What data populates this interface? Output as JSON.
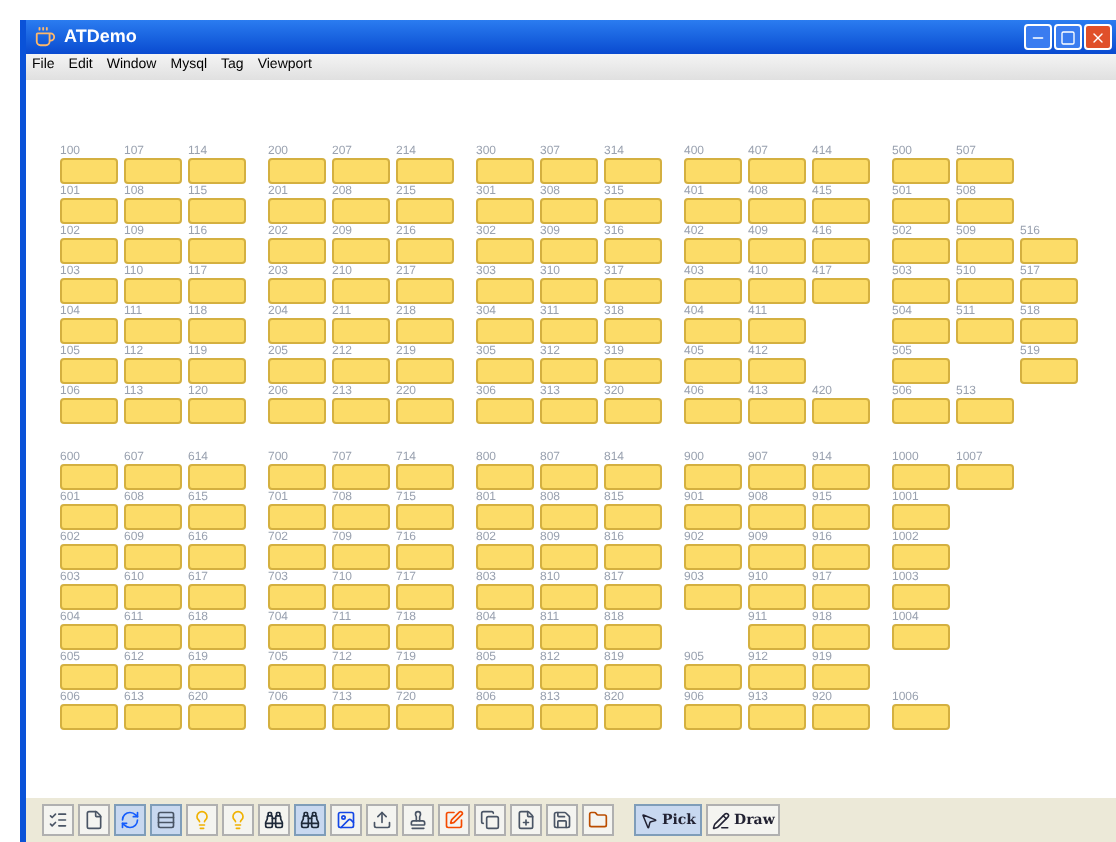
{
  "window": {
    "title": "ATDemo"
  },
  "menu": [
    "File",
    "Edit",
    "Window",
    "Mysql",
    "Tag",
    "Viewport"
  ],
  "bands": [
    {
      "groups": [
        {
          "columns": [
            {
              "cells": [
                {
                  "kind": "note",
                  "label": "100"
                },
                {
                  "kind": "note",
                  "label": "101"
                },
                {
                  "kind": "note",
                  "label": "102"
                },
                {
                  "kind": "note",
                  "label": "103"
                },
                {
                  "kind": "note",
                  "label": "104"
                },
                {
                  "kind": "note",
                  "label": "105"
                },
                {
                  "kind": "note",
                  "label": "106"
                }
              ]
            },
            {
              "cells": [
                {
                  "kind": "note",
                  "label": "107"
                },
                {
                  "kind": "note",
                  "label": "108"
                },
                {
                  "kind": "note",
                  "label": "109"
                },
                {
                  "kind": "note",
                  "label": "110"
                },
                {
                  "kind": "note",
                  "label": "111"
                },
                {
                  "kind": "note",
                  "label": "112"
                },
                {
                  "kind": "note",
                  "label": "113"
                }
              ]
            },
            {
              "cells": [
                {
                  "kind": "note",
                  "label": "114"
                },
                {
                  "kind": "note",
                  "label": "115"
                },
                {
                  "kind": "note",
                  "label": "116"
                },
                {
                  "kind": "note",
                  "label": "117"
                },
                {
                  "kind": "note",
                  "label": "118"
                },
                {
                  "kind": "note",
                  "label": "119"
                },
                {
                  "kind": "note",
                  "label": "120"
                }
              ]
            }
          ]
        },
        {
          "columns": [
            {
              "cells": [
                {
                  "kind": "note",
                  "label": "200"
                },
                {
                  "kind": "note",
                  "label": "201"
                },
                {
                  "kind": "note",
                  "label": "202"
                },
                {
                  "kind": "note",
                  "label": "203"
                },
                {
                  "kind": "note",
                  "label": "204"
                },
                {
                  "kind": "note",
                  "label": "205"
                },
                {
                  "kind": "note",
                  "label": "206"
                }
              ]
            },
            {
              "cells": [
                {
                  "kind": "note",
                  "label": "207"
                },
                {
                  "kind": "note",
                  "label": "208"
                },
                {
                  "kind": "note",
                  "label": "209"
                },
                {
                  "kind": "note",
                  "label": "210"
                },
                {
                  "kind": "note",
                  "label": "211"
                },
                {
                  "kind": "note",
                  "label": "212"
                },
                {
                  "kind": "note",
                  "label": "213"
                }
              ]
            },
            {
              "cells": [
                {
                  "kind": "note",
                  "label": "214"
                },
                {
                  "kind": "note",
                  "label": "215"
                },
                {
                  "kind": "note",
                  "label": "216"
                },
                {
                  "kind": "note",
                  "label": "217"
                },
                {
                  "kind": "note",
                  "label": "218"
                },
                {
                  "kind": "note",
                  "label": "219"
                },
                {
                  "kind": "note",
                  "label": "220"
                }
              ]
            }
          ]
        },
        {
          "columns": [
            {
              "cells": [
                {
                  "kind": "note",
                  "label": "300"
                },
                {
                  "kind": "note",
                  "label": "301"
                },
                {
                  "kind": "note",
                  "label": "302"
                },
                {
                  "kind": "note",
                  "label": "303"
                },
                {
                  "kind": "note",
                  "label": "304"
                },
                {
                  "kind": "note",
                  "label": "305"
                },
                {
                  "kind": "note",
                  "label": "306"
                }
              ]
            },
            {
              "cells": [
                {
                  "kind": "note",
                  "label": "307"
                },
                {
                  "kind": "note",
                  "label": "308"
                },
                {
                  "kind": "note",
                  "label": "309"
                },
                {
                  "kind": "note",
                  "label": "310"
                },
                {
                  "kind": "note",
                  "label": "311"
                },
                {
                  "kind": "note",
                  "label": "312"
                },
                {
                  "kind": "note",
                  "label": "313"
                }
              ]
            },
            {
              "cells": [
                {
                  "kind": "note",
                  "label": "314"
                },
                {
                  "kind": "note",
                  "label": "315"
                },
                {
                  "kind": "note",
                  "label": "316"
                },
                {
                  "kind": "note",
                  "label": "317"
                },
                {
                  "kind": "note",
                  "label": "318"
                },
                {
                  "kind": "note",
                  "label": "319"
                },
                {
                  "kind": "note",
                  "label": "320"
                }
              ]
            }
          ]
        },
        {
          "columns": [
            {
              "cells": [
                {
                  "kind": "note",
                  "label": "400"
                },
                {
                  "kind": "note",
                  "label": "401"
                },
                {
                  "kind": "note",
                  "label": "402"
                },
                {
                  "kind": "note",
                  "label": "403"
                },
                {
                  "kind": "note",
                  "label": "404"
                },
                {
                  "kind": "note",
                  "label": "405"
                },
                {
                  "kind": "note",
                  "label": "406"
                }
              ]
            },
            {
              "cells": [
                {
                  "kind": "note",
                  "label": "407"
                },
                {
                  "kind": "note",
                  "label": "408"
                },
                {
                  "kind": "note",
                  "label": "409"
                },
                {
                  "kind": "note",
                  "label": "410"
                },
                {
                  "kind": "note",
                  "label": "411"
                },
                {
                  "kind": "note",
                  "label": "412"
                },
                {
                  "kind": "note",
                  "label": "413"
                }
              ]
            },
            {
              "cells": [
                {
                  "kind": "note",
                  "label": "414"
                },
                {
                  "kind": "note",
                  "label": "415"
                },
                {
                  "kind": "note",
                  "label": "416"
                },
                {
                  "kind": "note",
                  "label": "417"
                },
                {
                  "kind": "gap"
                },
                {
                  "kind": "gap"
                },
                {
                  "kind": "note",
                  "label": "420"
                }
              ]
            }
          ]
        },
        {
          "columns": [
            {
              "cells": [
                {
                  "kind": "note",
                  "label": "500"
                },
                {
                  "kind": "note",
                  "label": "501"
                },
                {
                  "kind": "note",
                  "label": "502"
                },
                {
                  "kind": "note",
                  "label": "503"
                },
                {
                  "kind": "note",
                  "label": "504"
                },
                {
                  "kind": "note",
                  "label": "505"
                },
                {
                  "kind": "note",
                  "label": "506"
                }
              ]
            },
            {
              "cells": [
                {
                  "kind": "note",
                  "label": "507"
                },
                {
                  "kind": "note",
                  "label": "508"
                },
                {
                  "kind": "note",
                  "label": "509"
                },
                {
                  "kind": "note",
                  "label": "510"
                },
                {
                  "kind": "note",
                  "label": "511"
                },
                {
                  "kind": "gap"
                },
                {
                  "kind": "note",
                  "label": "513"
                }
              ]
            },
            {
              "cells": [
                {
                  "kind": "gap"
                },
                {
                  "kind": "gap"
                },
                {
                  "kind": "note",
                  "label": "516"
                },
                {
                  "kind": "note",
                  "label": "517"
                },
                {
                  "kind": "note",
                  "label": "518"
                },
                {
                  "kind": "note",
                  "label": "519"
                }
              ]
            }
          ]
        }
      ]
    },
    {
      "groups": [
        {
          "columns": [
            {
              "cells": [
                {
                  "kind": "note",
                  "label": "600"
                },
                {
                  "kind": "note",
                  "label": "601"
                },
                {
                  "kind": "note",
                  "label": "602"
                },
                {
                  "kind": "note",
                  "label": "603"
                },
                {
                  "kind": "note",
                  "label": "604"
                },
                {
                  "kind": "note",
                  "label": "605"
                },
                {
                  "kind": "note",
                  "label": "606"
                }
              ]
            },
            {
              "cells": [
                {
                  "kind": "note",
                  "label": "607"
                },
                {
                  "kind": "note",
                  "label": "608"
                },
                {
                  "kind": "note",
                  "label": "609"
                },
                {
                  "kind": "note",
                  "label": "610"
                },
                {
                  "kind": "note",
                  "label": "611"
                },
                {
                  "kind": "note",
                  "label": "612"
                },
                {
                  "kind": "note",
                  "label": "613"
                }
              ]
            },
            {
              "cells": [
                {
                  "kind": "note",
                  "label": "614"
                },
                {
                  "kind": "note",
                  "label": "615"
                },
                {
                  "kind": "note",
                  "label": "616"
                },
                {
                  "kind": "note",
                  "label": "617"
                },
                {
                  "kind": "note",
                  "label": "618"
                },
                {
                  "kind": "note",
                  "label": "619"
                },
                {
                  "kind": "note",
                  "label": "620"
                }
              ]
            }
          ]
        },
        {
          "columns": [
            {
              "cells": [
                {
                  "kind": "note",
                  "label": "700"
                },
                {
                  "kind": "note",
                  "label": "701"
                },
                {
                  "kind": "note",
                  "label": "702"
                },
                {
                  "kind": "note",
                  "label": "703"
                },
                {
                  "kind": "note",
                  "label": "704"
                },
                {
                  "kind": "note",
                  "label": "705"
                },
                {
                  "kind": "note",
                  "label": "706"
                }
              ]
            },
            {
              "cells": [
                {
                  "kind": "note",
                  "label": "707"
                },
                {
                  "kind": "note",
                  "label": "708"
                },
                {
                  "kind": "note",
                  "label": "709"
                },
                {
                  "kind": "note",
                  "label": "710"
                },
                {
                  "kind": "note",
                  "label": "711"
                },
                {
                  "kind": "note",
                  "label": "712"
                },
                {
                  "kind": "note",
                  "label": "713"
                }
              ]
            },
            {
              "cells": [
                {
                  "kind": "note",
                  "label": "714"
                },
                {
                  "kind": "note",
                  "label": "715"
                },
                {
                  "kind": "note",
                  "label": "716"
                },
                {
                  "kind": "note",
                  "label": "717"
                },
                {
                  "kind": "note",
                  "label": "718"
                },
                {
                  "kind": "note",
                  "label": "719"
                },
                {
                  "kind": "note",
                  "label": "720"
                }
              ]
            }
          ]
        },
        {
          "columns": [
            {
              "cells": [
                {
                  "kind": "note",
                  "label": "800"
                },
                {
                  "kind": "note",
                  "label": "801"
                },
                {
                  "kind": "note",
                  "label": "802"
                },
                {
                  "kind": "note",
                  "label": "803"
                },
                {
                  "kind": "note",
                  "label": "804"
                },
                {
                  "kind": "note",
                  "label": "805"
                },
                {
                  "kind": "note",
                  "label": "806"
                }
              ]
            },
            {
              "cells": [
                {
                  "kind": "note",
                  "label": "807"
                },
                {
                  "kind": "note",
                  "label": "808"
                },
                {
                  "kind": "note",
                  "label": "809"
                },
                {
                  "kind": "note",
                  "label": "810"
                },
                {
                  "kind": "note",
                  "label": "811"
                },
                {
                  "kind": "note",
                  "label": "812"
                },
                {
                  "kind": "note",
                  "label": "813"
                }
              ]
            },
            {
              "cells": [
                {
                  "kind": "note",
                  "label": "814"
                },
                {
                  "kind": "note",
                  "label": "815"
                },
                {
                  "kind": "note",
                  "label": "816"
                },
                {
                  "kind": "note",
                  "label": "817"
                },
                {
                  "kind": "note",
                  "label": "818"
                },
                {
                  "kind": "note",
                  "label": "819"
                },
                {
                  "kind": "note",
                  "label": "820"
                }
              ]
            }
          ]
        },
        {
          "columns": [
            {
              "cells": [
                {
                  "kind": "note",
                  "label": "900"
                },
                {
                  "kind": "note",
                  "label": "901"
                },
                {
                  "kind": "note",
                  "label": "902"
                },
                {
                  "kind": "note",
                  "label": "903"
                },
                {
                  "kind": "gap"
                },
                {
                  "kind": "note",
                  "label": "905"
                },
                {
                  "kind": "note",
                  "label": "906"
                }
              ]
            },
            {
              "cells": [
                {
                  "kind": "note",
                  "label": "907"
                },
                {
                  "kind": "note",
                  "label": "908"
                },
                {
                  "kind": "note",
                  "label": "909"
                },
                {
                  "kind": "note",
                  "label": "910"
                },
                {
                  "kind": "note",
                  "label": "911"
                },
                {
                  "kind": "note",
                  "label": "912"
                },
                {
                  "kind": "note",
                  "label": "913"
                }
              ]
            },
            {
              "cells": [
                {
                  "kind": "note",
                  "label": "914"
                },
                {
                  "kind": "note",
                  "label": "915"
                },
                {
                  "kind": "note",
                  "label": "916"
                },
                {
                  "kind": "note",
                  "label": "917"
                },
                {
                  "kind": "note",
                  "label": "918"
                },
                {
                  "kind": "note",
                  "label": "919"
                },
                {
                  "kind": "note",
                  "label": "920"
                }
              ]
            }
          ]
        },
        {
          "columns": [
            {
              "cells": [
                {
                  "kind": "note",
                  "label": "1000"
                },
                {
                  "kind": "note",
                  "label": "1001"
                },
                {
                  "kind": "note",
                  "label": "1002"
                },
                {
                  "kind": "note",
                  "label": "1003"
                },
                {
                  "kind": "note",
                  "label": "1004"
                },
                {
                  "kind": "gap"
                },
                {
                  "kind": "note",
                  "label": "1006"
                }
              ]
            },
            {
              "cells": [
                {
                  "kind": "note",
                  "label": "1007"
                }
              ]
            }
          ]
        }
      ]
    }
  ],
  "toolbar": [
    {
      "kind": "checklist",
      "selected": false
    },
    {
      "kind": "page",
      "selected": false
    },
    {
      "kind": "refresh",
      "selected": true
    },
    {
      "kind": "rows",
      "selected": true
    },
    {
      "kind": "bulb",
      "selected": false
    },
    {
      "kind": "bulb",
      "selected": false
    },
    {
      "kind": "binoculars",
      "selected": false
    },
    {
      "kind": "binoculars",
      "selected": true
    },
    {
      "kind": "image",
      "selected": false
    },
    {
      "kind": "upload",
      "selected": false
    },
    {
      "kind": "stamp",
      "selected": false
    },
    {
      "kind": "edit",
      "selected": false
    },
    {
      "kind": "copy",
      "selected": false
    },
    {
      "kind": "page-add",
      "selected": false
    },
    {
      "kind": "save",
      "selected": false
    },
    {
      "kind": "folder",
      "selected": false
    }
  ],
  "modes": [
    {
      "kind": "pick",
      "label": "Pick",
      "selected": true
    },
    {
      "kind": "draw",
      "label": "Draw",
      "selected": false
    }
  ]
}
